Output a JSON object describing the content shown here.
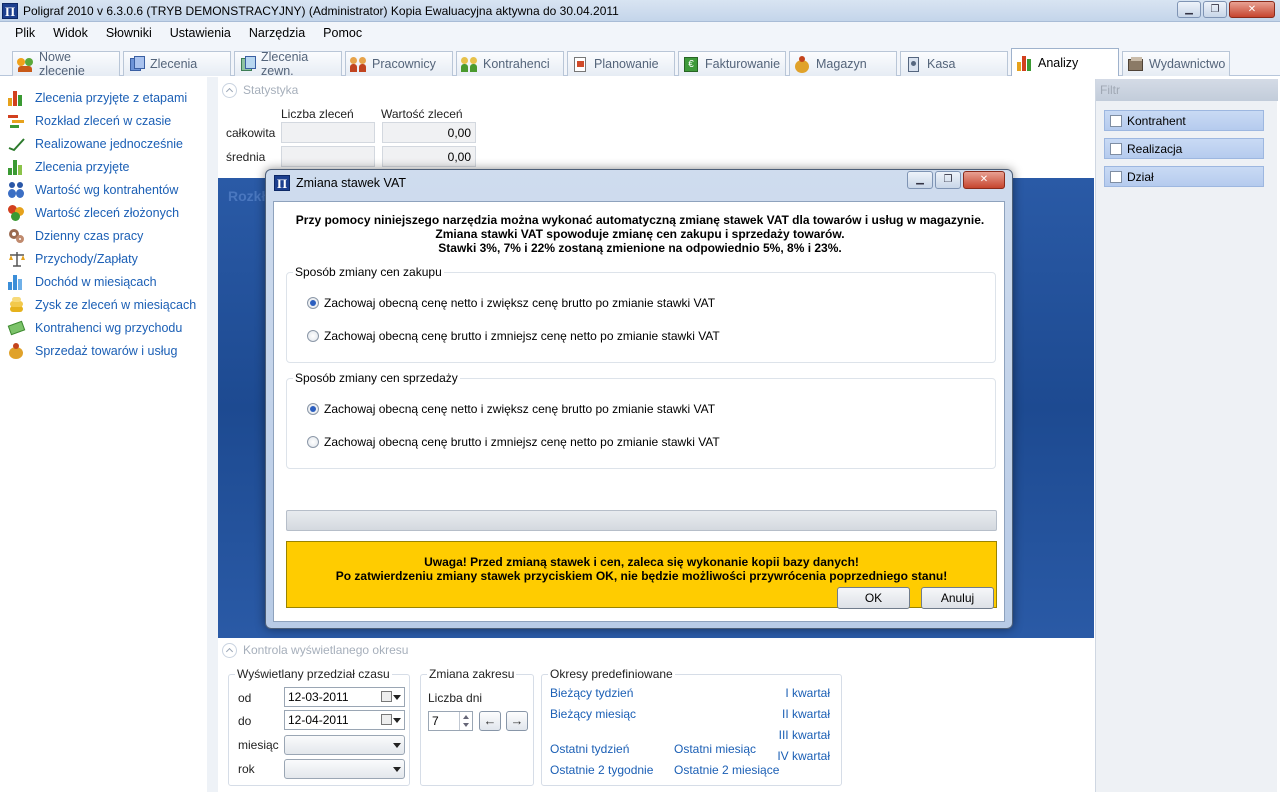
{
  "window": {
    "title": "Poligraf 2010 v 6.3.0.6 (TRYB DEMONSTRACYJNY) (Administrator) Kopia Ewaluacyjna aktywna do 30.04.2011",
    "logo_letter": "Π"
  },
  "menu": [
    "Plik",
    "Widok",
    "Słowniki",
    "Ustawienia",
    "Narzędzia",
    "Pomoc"
  ],
  "tabs": [
    {
      "label": "Nowe zlecenie",
      "icon": "new-order-icon"
    },
    {
      "label": "Zlecenia",
      "icon": "orders-icon"
    },
    {
      "label": "Zlecenia zewn.",
      "icon": "external-orders-icon"
    },
    {
      "label": "Pracownicy",
      "icon": "employees-icon"
    },
    {
      "label": "Kontrahenci",
      "icon": "contractors-icon"
    },
    {
      "label": "Planowanie",
      "icon": "planning-icon"
    },
    {
      "label": "Fakturowanie",
      "icon": "invoice-icon"
    },
    {
      "label": "Magazyn",
      "icon": "warehouse-icon"
    },
    {
      "label": "Kasa",
      "icon": "cash-register-icon"
    },
    {
      "label": "Analizy",
      "icon": "analysis-chart-icon",
      "active": true
    },
    {
      "label": "Wydawnictwo",
      "icon": "publishing-icon"
    }
  ],
  "sidebar": {
    "items": [
      {
        "label": "Zlecenia przyjęte z etapami",
        "icon": "bar-chart-icon"
      },
      {
        "label": "Rozkład zleceń w czasie",
        "icon": "gantt-icon"
      },
      {
        "label": "Realizowane jednocześnie",
        "icon": "trend-line-icon"
      },
      {
        "label": "Zlecenia przyjęte",
        "icon": "bar-chart-icon"
      },
      {
        "label": "Wartość wg kontrahentów",
        "icon": "people-icon"
      },
      {
        "label": "Wartość zleceń złożonych",
        "icon": "coins-icon"
      },
      {
        "label": "Dzienny czas pracy",
        "icon": "gears-icon"
      },
      {
        "label": "Przychody/Zapłaty",
        "icon": "scales-icon"
      },
      {
        "label": "Dochód w miesiącach",
        "icon": "bar-chart-blue-icon"
      },
      {
        "label": "Zysk ze zleceń w miesiącach",
        "icon": "coin-stack-icon"
      },
      {
        "label": "Kontrahenci wg przychodu",
        "icon": "money-icon"
      },
      {
        "label": "Sprzedaż towarów i usług",
        "icon": "money-bag-icon"
      }
    ]
  },
  "stats": {
    "header": "Statystyka",
    "col_count": "Liczba zleceń",
    "col_value": "Wartość zleceń",
    "rows": [
      {
        "label": "całkowita",
        "count": "",
        "value": "0,00"
      },
      {
        "label": "średnia",
        "count": "",
        "value": "0,00"
      }
    ]
  },
  "band_title": "Rozkł",
  "filter": {
    "header": "Filtr",
    "items": [
      "Kontrahent",
      "Realizacja",
      "Dział"
    ]
  },
  "period": {
    "header": "Kontrola wyświetlanego okresu",
    "range_group": "Wyświetlany przedział czasu",
    "od_label": "od",
    "od_value": "12-03-2011",
    "do_label": "do",
    "do_value": "12-04-2011",
    "month_label": "miesiąc",
    "month_value": "",
    "year_label": "rok",
    "year_value": "",
    "change_group": "Zmiana zakresu",
    "days_label": "Liczba dni",
    "days_value": "7",
    "prev_arrow": "←",
    "next_arrow": "→",
    "predef_group": "Okresy predefiniowane",
    "links": {
      "this_week": "Bieżący tydzień",
      "this_month": "Bieżący miesiąc",
      "last_week": "Ostatni tydzień",
      "last_2_weeks": "Ostatnie 2 tygodnie",
      "last_month": "Ostatni miesiąc",
      "last_2_months": "Ostatnie 2 miesiące",
      "q1": "I kwartał",
      "q2": "II kwartał",
      "q3": "III kwartał",
      "q4": "IV kwartał"
    }
  },
  "dialog": {
    "title": "Zmiana stawek VAT",
    "intro": [
      "Przy pomocy niniejszego narzędzia można wykonać automatyczną zmianę stawek VAT dla towarów i usług w magazynie.",
      "Zmiana stawki VAT spowoduje zmianę cen zakupu i sprzedaży towarów.",
      "Stawki 3%, 7% i 22% zostaną zmienione na odpowiednio 5%, 8% i 23%."
    ],
    "purchase_group": "Sposób zmiany cen zakupu",
    "sales_group": "Sposób zmiany cen sprzedaży",
    "option_keep_net": "Zachowaj obecną cenę netto i zwiększ cenę brutto po zmianie stawki VAT",
    "option_keep_gross": "Zachowaj obecną cenę brutto i zmniejsz cenę netto po zmianie stawki VAT",
    "purchase_selected": "keep_net",
    "sales_selected": "keep_net",
    "progress": 0,
    "warning": [
      "Uwaga! Przed zmianą stawek i cen, zaleca się wykonanie kopii bazy danych!",
      "Po zatwierdzeniu zmiany stawek przyciskiem OK, nie będzie możliwości przywrócenia poprzedniego stanu!"
    ],
    "ok": "OK",
    "cancel": "Anuluj"
  },
  "colors": {
    "accent_blue": "#1b5fb5",
    "warning_yellow": "#ffcc00",
    "band_blue": "#2a5aa6"
  }
}
